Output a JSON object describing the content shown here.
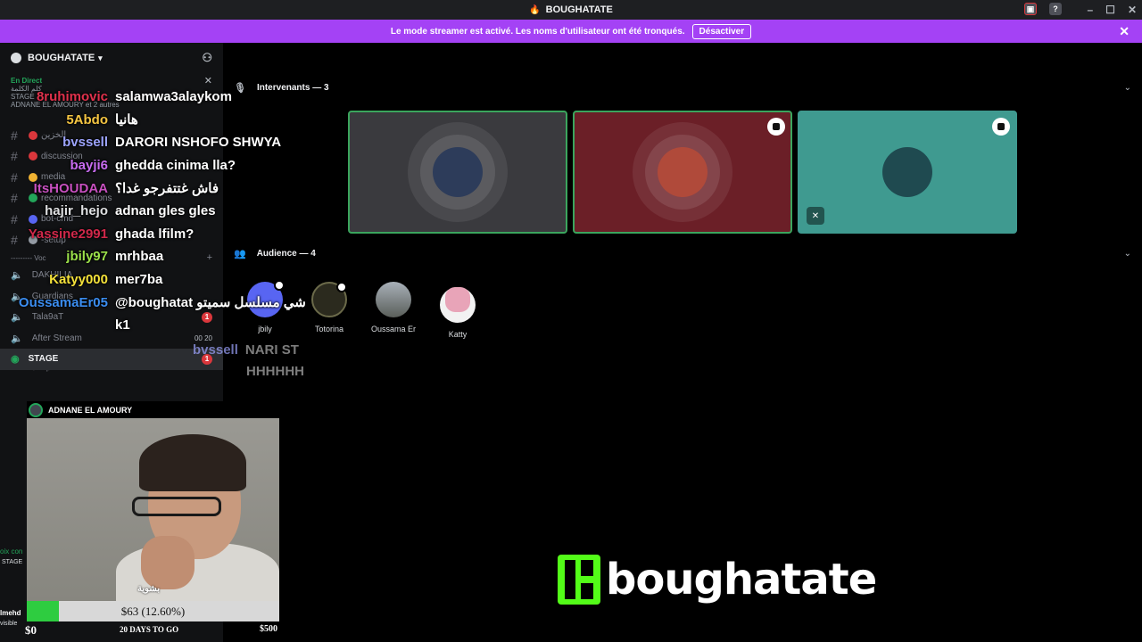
{
  "window": {
    "title": "BOUGHATATE",
    "title_icon": "flame-icon"
  },
  "banner": {
    "text": "Le mode streamer est activé. Les noms d'utilisateur ont été tronqués.",
    "button": "Désactiver",
    "bg": "#a442f5"
  },
  "sidebar": {
    "server_name": "BOUGHATATE",
    "live": {
      "status": "En Direct",
      "line1": "كلم الكلمة",
      "line2": "STAGE",
      "line3": "ADNANE EL AMOURY et 2 autres"
    },
    "channels": [
      {
        "label": "الخزين",
        "type": "text",
        "dot": "#da373c"
      },
      {
        "label": "discussion",
        "type": "text",
        "dot": "#da373c"
      },
      {
        "label": "media",
        "type": "text",
        "dot": "#f0b232"
      },
      {
        "label": "recommandations",
        "type": "text",
        "dot": "#23a55a"
      },
      {
        "label": "bot-cmd",
        "type": "text",
        "dot": "#5865f2"
      },
      {
        "label": "-setup",
        "type": "text",
        "dot": "#949ba4"
      }
    ],
    "voice_category": "--------- Voc",
    "voice_channels": [
      {
        "label": "DAKHILIA",
        "timer": ""
      },
      {
        "label": "Guardians",
        "timer": ""
      },
      {
        "label": "Tala9aT",
        "badge": "1",
        "timer": ""
      },
      {
        "label": "After Stream",
        "timer": "00 20"
      }
    ],
    "stage": {
      "label": "STAGE",
      "sublabel": "كلم الكلمة",
      "badge": "1"
    },
    "stage_member": "ADNANE EL AMOURY",
    "fragments": {
      "a": "oix con",
      "b": "STAGE",
      "c": "lmehd",
      "d": "visible"
    }
  },
  "main": {
    "speakers_header": "Intervenants — 3",
    "audience_header": "Audience — 4",
    "speakers": [
      {
        "bg": "#3a3a3e",
        "border": "#3ba55d",
        "pic": "#2d3c5a",
        "mod": false,
        "muted": false
      },
      {
        "bg": "#6b1f27",
        "border": "#3ba55d",
        "pic": "#b04a3a",
        "mod": true,
        "muted": false
      },
      {
        "bg": "#3f9a90",
        "border": "#3f9a90",
        "pic": "#1f4a50",
        "mod": true,
        "muted": true
      }
    ],
    "audience": [
      {
        "name": "jbily",
        "color": "#5865f2"
      },
      {
        "name": "Totorina",
        "color": "#2b2a1e"
      },
      {
        "name": "Oussama Er",
        "color": "#6b6f6a"
      },
      {
        "name": "Katty",
        "color": "#e8a4b8"
      }
    ]
  },
  "chat": [
    {
      "user": "8ruhimovic",
      "color": "#e0314c",
      "text": "salamwa3alaykom"
    },
    {
      "user": "5Abdo",
      "color": "#f5c542",
      "text": "هانيا"
    },
    {
      "user": "bvssell",
      "color": "#9da4ff",
      "text": "DARORI NSHOFO SHWYA"
    },
    {
      "user": "bayji6",
      "color": "#c86cf0",
      "text": "ghedda cinima lla?"
    },
    {
      "user": "ItsHOUDAA",
      "color": "#c850c0",
      "text": "فاش غتتفرجو غدا؟"
    },
    {
      "user": "hajir_hejo",
      "color": "#dfe0e2",
      "text": "adnan gles gles"
    },
    {
      "user": "Yassine2991",
      "color": "#d0284a",
      "text": "ghada lfilm?"
    },
    {
      "user": "jbily97",
      "color": "#9be04a",
      "text": "mrhbaa"
    },
    {
      "user": "Katyy000",
      "color": "#f5e23a",
      "text": "mer7ba"
    },
    {
      "user": "OussamaEr05",
      "color": "#3b8df0",
      "text": "@boughatat شي مسلسل سميتو"
    },
    {
      "user": "",
      "color": "#ffffff",
      "text": "k1"
    }
  ],
  "chat_faded": {
    "user": "bvssell",
    "line1": "NARI ST",
    "line2": "HHHHHH"
  },
  "webcam": {
    "caption": "بشوية"
  },
  "goal": {
    "label": "$63 (12.60%)",
    "progress": 0.126,
    "start": "$0",
    "remaining": "20 DAYS TO GO",
    "target": "$500"
  },
  "brand": {
    "name": "boughatate",
    "accent": "#53fc18"
  }
}
